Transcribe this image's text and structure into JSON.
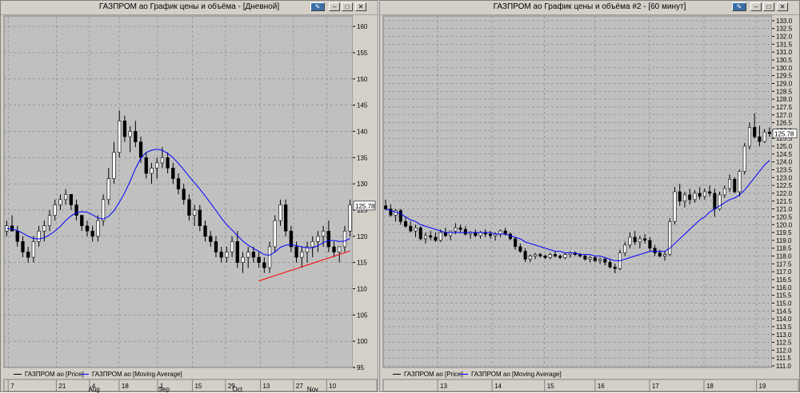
{
  "windows": [
    {
      "title": "ГАЗПРОМ ао График цены и объёма - [Дневной]",
      "legend": [
        {
          "label": "ГАЗПРОМ ао [Price]",
          "color": "#000000"
        },
        {
          "label": "ГАЗПРОМ ао [Moving Average]",
          "color": "#0000ff"
        }
      ],
      "last_price_label": "125.78"
    },
    {
      "title": "ГАЗПРОМ ао График цены и объёма #2 - [60 минут]",
      "legend": [
        {
          "label": "ГАЗПРОМ ао [Price]",
          "color": "#000000"
        },
        {
          "label": "ГАЗПРОМ ао [Moving Average]",
          "color": "#0000ff"
        }
      ],
      "last_price_label": "125.78"
    }
  ],
  "chart_data": [
    {
      "type": "candlestick",
      "ylim": [
        95,
        162
      ],
      "y_ticks": [
        "95",
        "100",
        "105",
        "110",
        "115",
        "120",
        "125",
        "130",
        "135",
        "140",
        "145",
        "150",
        "155",
        "160"
      ],
      "x_day_labels": [
        "7",
        "21",
        "4",
        "18",
        "1",
        "15",
        "29",
        "13",
        "27",
        "10"
      ],
      "x_month_labels": [
        "Aug",
        "Sep",
        "Oct",
        "Nov"
      ],
      "colors": {
        "background": "#c0c0c0",
        "up": "#ffffff",
        "down": "#000000",
        "moving_average": "#0000ff",
        "trendline": "#ff0000",
        "grid": "#808080"
      },
      "ohlc": [
        [
          121,
          123,
          120,
          122
        ],
        [
          122,
          124,
          121,
          121
        ],
        [
          121,
          122,
          118,
          119
        ],
        [
          119,
          120,
          116,
          117
        ],
        [
          117,
          118,
          115,
          116
        ],
        [
          116,
          120,
          115,
          119
        ],
        [
          119,
          122,
          118,
          121
        ],
        [
          121,
          123,
          119,
          122
        ],
        [
          122,
          125,
          121,
          124
        ],
        [
          124,
          127,
          123,
          126
        ],
        [
          126,
          128,
          125,
          127
        ],
        [
          127,
          129,
          126,
          128
        ],
        [
          128,
          128,
          125,
          126
        ],
        [
          126,
          127,
          123,
          124
        ],
        [
          124,
          124,
          121,
          122
        ],
        [
          122,
          123,
          120,
          121
        ],
        [
          121,
          122,
          119,
          120
        ],
        [
          120,
          124,
          119,
          123
        ],
        [
          123,
          128,
          122,
          127
        ],
        [
          127,
          133,
          126,
          131
        ],
        [
          131,
          138,
          130,
          136
        ],
        [
          136,
          144,
          135,
          142
        ],
        [
          142,
          143,
          138,
          139
        ],
        [
          139,
          141,
          136,
          140
        ],
        [
          140,
          142,
          137,
          138
        ],
        [
          138,
          139,
          134,
          135
        ],
        [
          135,
          136,
          131,
          132
        ],
        [
          132,
          134,
          130,
          133
        ],
        [
          133,
          135,
          131,
          134
        ],
        [
          134,
          137,
          133,
          135
        ],
        [
          135,
          136,
          132,
          133
        ],
        [
          133,
          134,
          130,
          131
        ],
        [
          131,
          132,
          128,
          129
        ],
        [
          129,
          130,
          126,
          127
        ],
        [
          127,
          128,
          123,
          124
        ],
        [
          124,
          126,
          122,
          125
        ],
        [
          125,
          126,
          121,
          122
        ],
        [
          122,
          123,
          119,
          120
        ],
        [
          120,
          121,
          118,
          119
        ],
        [
          119,
          120,
          116,
          117
        ],
        [
          117,
          118,
          115,
          116
        ],
        [
          116,
          118,
          115,
          117
        ],
        [
          117,
          120,
          116,
          119
        ],
        [
          119,
          121,
          114,
          115
        ],
        [
          115,
          117,
          113,
          116
        ],
        [
          116,
          118,
          114,
          117
        ],
        [
          117,
          118,
          115,
          116
        ],
        [
          116,
          117,
          114,
          115
        ],
        [
          115,
          116,
          113,
          114
        ],
        [
          114,
          119,
          113,
          118
        ],
        [
          118,
          124,
          117,
          123
        ],
        [
          123,
          127,
          122,
          126
        ],
        [
          126,
          127,
          120,
          121
        ],
        [
          121,
          122,
          117,
          118
        ],
        [
          118,
          119,
          115,
          116
        ],
        [
          116,
          118,
          114,
          117
        ],
        [
          117,
          119,
          115,
          118
        ],
        [
          118,
          120,
          116,
          119
        ],
        [
          119,
          121,
          117,
          120
        ],
        [
          120,
          122,
          118,
          121
        ],
        [
          121,
          123,
          117,
          118
        ],
        [
          118,
          119,
          116,
          117
        ],
        [
          117,
          118,
          115,
          118
        ],
        [
          118,
          122,
          117,
          121
        ],
        [
          121,
          127,
          120,
          126
        ]
      ],
      "moving_average": [
        121.5,
        121.4,
        121.1,
        120.6,
        120.0,
        119.6,
        119.5,
        119.7,
        120.3,
        121.0,
        121.9,
        123.0,
        123.9,
        124.5,
        124.7,
        124.6,
        124.1,
        123.5,
        123.3,
        123.8,
        124.9,
        126.5,
        128.3,
        130.5,
        132.9,
        134.9,
        136.0,
        136.4,
        136.6,
        136.4,
        135.8,
        135.0,
        133.9,
        132.7,
        131.4,
        130.2,
        129.0,
        127.7,
        126.3,
        124.9,
        123.5,
        122.2,
        121.2,
        120.1,
        119.1,
        118.3,
        117.7,
        117.1,
        116.5,
        116.4,
        117.0,
        117.9,
        118.3,
        118.4,
        118.2,
        118.0,
        117.8,
        117.8,
        118.2,
        118.8,
        119.2,
        119.2,
        119.0,
        119.1,
        119.6
      ],
      "trendline": [
        [
          47,
          111.5
        ],
        [
          64,
          117.2
        ]
      ],
      "last_price": 125.78
    },
    {
      "type": "candlestick",
      "ylim": [
        110.9,
        133.3
      ],
      "y_ticks": [
        "111.0",
        "111.5",
        "112.0",
        "112.5",
        "113.0",
        "113.5",
        "114.0",
        "114.5",
        "115.0",
        "115.5",
        "116.0",
        "116.5",
        "117.0",
        "117.5",
        "118.0",
        "118.5",
        "119.0",
        "119.5",
        "120.0",
        "120.5",
        "121.0",
        "121.5",
        "122.0",
        "122.5",
        "123.0",
        "123.5",
        "124.0",
        "124.5",
        "125.0",
        "125.5",
        "126.0",
        "126.5",
        "127.0",
        "127.5",
        "128.0",
        "128.5",
        "129.0",
        "129.5",
        "130.0",
        "130.5",
        "131.0",
        "131.5",
        "132.0",
        "132.5",
        "133.0"
      ],
      "x_day_labels": [
        "13",
        "14",
        "15",
        "16",
        "17",
        "18",
        "19"
      ],
      "colors": {
        "background": "#c0c0c0",
        "up": "#ffffff",
        "down": "#000000",
        "moving_average": "#0000ff",
        "grid": "#808080"
      },
      "ohlc": [
        [
          121.2,
          121.6,
          120.9,
          121.0
        ],
        [
          121.0,
          121.3,
          120.5,
          120.6
        ],
        [
          120.6,
          121.0,
          120.2,
          120.9
        ],
        [
          120.9,
          121.0,
          120.0,
          120.2
        ],
        [
          120.2,
          120.5,
          119.8,
          119.9
        ],
        [
          119.9,
          120.2,
          119.5,
          119.6
        ],
        [
          119.6,
          120.0,
          119.2,
          119.8
        ],
        [
          119.8,
          119.9,
          119.0,
          119.1
        ],
        [
          119.1,
          119.5,
          118.8,
          119.3
        ],
        [
          119.3,
          119.6,
          119.0,
          119.2
        ],
        [
          119.2,
          119.5,
          118.9,
          119.0
        ],
        [
          119.0,
          119.7,
          118.9,
          119.5
        ],
        [
          119.5,
          119.8,
          119.2,
          119.3
        ],
        [
          119.3,
          119.6,
          119.0,
          119.6
        ],
        [
          119.6,
          120.1,
          119.4,
          119.8
        ],
        [
          119.8,
          120.0,
          119.5,
          119.7
        ],
        [
          119.7,
          119.9,
          119.3,
          119.4
        ],
        [
          119.4,
          119.6,
          119.1,
          119.5
        ],
        [
          119.5,
          119.7,
          119.2,
          119.3
        ],
        [
          119.3,
          119.6,
          119.1,
          119.5
        ],
        [
          119.5,
          119.7,
          119.2,
          119.4
        ],
        [
          119.4,
          119.6,
          119.1,
          119.3
        ],
        [
          119.3,
          119.5,
          119.0,
          119.4
        ],
        [
          119.4,
          119.7,
          119.2,
          119.6
        ],
        [
          119.6,
          119.8,
          119.3,
          119.4
        ],
        [
          119.4,
          119.5,
          119.0,
          119.1
        ],
        [
          119.1,
          119.2,
          118.4,
          118.6
        ],
        [
          118.6,
          118.8,
          118.2,
          118.3
        ],
        [
          118.3,
          118.5,
          117.6,
          117.8
        ],
        [
          117.8,
          118.1,
          117.6,
          118.0
        ],
        [
          118.0,
          118.2,
          117.8,
          118.1
        ],
        [
          118.1,
          118.2,
          117.9,
          118.0
        ],
        [
          118.0,
          118.1,
          117.8,
          117.9
        ],
        [
          117.9,
          118.2,
          117.8,
          118.1
        ],
        [
          118.1,
          118.3,
          117.9,
          118.0
        ],
        [
          118.0,
          118.1,
          117.8,
          117.9
        ],
        [
          117.9,
          118.2,
          117.8,
          118.1
        ],
        [
          118.1,
          118.3,
          117.9,
          118.2
        ],
        [
          118.2,
          118.3,
          118.0,
          118.1
        ],
        [
          118.1,
          118.2,
          117.9,
          118.0
        ],
        [
          118.0,
          118.1,
          117.7,
          117.8
        ],
        [
          117.8,
          118.0,
          117.6,
          117.9
        ],
        [
          117.9,
          118.0,
          117.6,
          117.7
        ],
        [
          117.7,
          117.9,
          117.5,
          117.8
        ],
        [
          117.8,
          117.9,
          117.4,
          117.6
        ],
        [
          117.6,
          117.8,
          117.2,
          117.3
        ],
        [
          117.3,
          117.5,
          116.9,
          117.2
        ],
        [
          117.2,
          118.4,
          117.1,
          118.2
        ],
        [
          118.2,
          118.9,
          118.0,
          118.7
        ],
        [
          118.7,
          119.5,
          118.5,
          119.2
        ],
        [
          119.2,
          119.6,
          118.7,
          118.9
        ],
        [
          118.9,
          119.3,
          118.5,
          119.1
        ],
        [
          119.1,
          119.4,
          118.8,
          119.0
        ],
        [
          119.0,
          119.2,
          118.3,
          118.5
        ],
        [
          118.5,
          118.7,
          118.0,
          118.2
        ],
        [
          118.2,
          118.4,
          117.9,
          118.0
        ],
        [
          118.0,
          118.3,
          117.7,
          118.1
        ],
        [
          118.1,
          120.4,
          118.0,
          120.2
        ],
        [
          120.2,
          122.4,
          120.0,
          122.1
        ],
        [
          122.1,
          122.6,
          121.2,
          121.5
        ],
        [
          121.5,
          122.1,
          121.1,
          121.9
        ],
        [
          121.9,
          122.3,
          121.3,
          121.6
        ],
        [
          121.6,
          122.2,
          121.4,
          122.0
        ],
        [
          122.0,
          122.4,
          121.6,
          121.8
        ],
        [
          121.8,
          122.3,
          121.6,
          122.1
        ],
        [
          122.1,
          122.5,
          121.8,
          122.0
        ],
        [
          122.0,
          122.3,
          120.5,
          121.0
        ],
        [
          121.0,
          122.1,
          120.9,
          121.9
        ],
        [
          121.9,
          122.5,
          121.7,
          122.3
        ],
        [
          122.3,
          123.2,
          122.1,
          122.9
        ],
        [
          122.9,
          123.0,
          122.0,
          122.1
        ],
        [
          122.1,
          123.5,
          121.8,
          123.4
        ],
        [
          123.4,
          125.2,
          123.2,
          125.0
        ],
        [
          125.0,
          126.5,
          124.8,
          126.2
        ],
        [
          126.2,
          127.1,
          125.5,
          125.6
        ],
        [
          125.6,
          126.3,
          125.0,
          125.3
        ],
        [
          125.3,
          126.1,
          125.2,
          125.9
        ],
        [
          125.9,
          126.2,
          125.6,
          125.8
        ]
      ],
      "moving_average": [
        121.0,
        120.9,
        120.8,
        120.7,
        120.5,
        120.3,
        120.2,
        120.0,
        119.9,
        119.8,
        119.7,
        119.6,
        119.5,
        119.5,
        119.5,
        119.5,
        119.5,
        119.5,
        119.5,
        119.5,
        119.5,
        119.5,
        119.4,
        119.4,
        119.4,
        119.3,
        119.2,
        119.1,
        118.9,
        118.8,
        118.7,
        118.6,
        118.5,
        118.4,
        118.3,
        118.3,
        118.2,
        118.2,
        118.2,
        118.1,
        118.1,
        118.1,
        118.0,
        118.0,
        117.9,
        117.8,
        117.7,
        117.7,
        117.8,
        117.9,
        118.0,
        118.1,
        118.2,
        118.3,
        118.3,
        118.3,
        118.3,
        118.5,
        118.8,
        119.1,
        119.4,
        119.7,
        120.0,
        120.3,
        120.5,
        120.8,
        121.0,
        121.2,
        121.4,
        121.6,
        121.7,
        121.9,
        122.2,
        122.6,
        123.0,
        123.4,
        123.8,
        124.1
      ],
      "last_price": 125.78
    }
  ]
}
